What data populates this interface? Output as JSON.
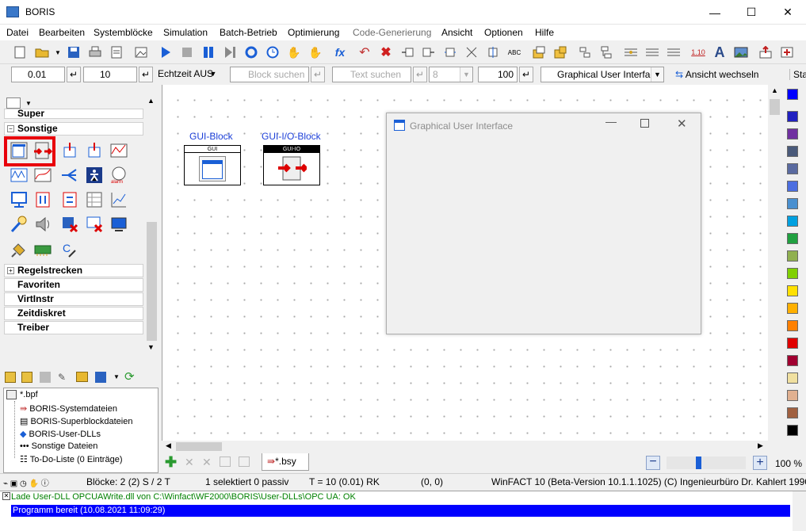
{
  "window": {
    "title": "BORIS",
    "minimize": "—",
    "maximize": "☐",
    "close": "✕"
  },
  "menu": [
    "Datei",
    "Bearbeiten",
    "Systemblöcke",
    "Simulation",
    "Batch-Betrieb",
    "Optimierung",
    "Code-Generierung",
    "Ansicht",
    "Optionen",
    "Hilfe"
  ],
  "menu_disabled": "Code-Generierung",
  "toolbar2": {
    "step_value": "0.01",
    "end_value": "10",
    "realtime": "Echtzeit AUS",
    "block_search_placeholder": "Block suchen",
    "text_search_placeholder": "Text suchen",
    "text_search_count": "8",
    "width_value": "100",
    "view_select": "Graphical User Interface",
    "switch_view": "Ansicht wechseln",
    "overflow": "Sta"
  },
  "palette": {
    "headers_top": [
      {
        "label": "Super",
        "state": "+"
      },
      {
        "label": "Sonstige",
        "state": "−"
      }
    ],
    "headers_bottom": [
      {
        "label": "Regelstrecken",
        "state": "+"
      },
      {
        "label": "Favoriten",
        "state": ""
      },
      {
        "label": "VirtInstr",
        "state": ""
      },
      {
        "label": "Zeitdiskret",
        "state": ""
      },
      {
        "label": "Treiber",
        "state": ""
      }
    ]
  },
  "tree": {
    "root": "*.bpf",
    "items": [
      "BORIS-Systemdateien",
      "BORIS-Superblockdateien",
      "BORIS-User-DLLs",
      "Sonstige Dateien",
      "To-Do-Liste (0 Einträge)"
    ]
  },
  "canvas": {
    "blocks": [
      {
        "title": "GUI-Block",
        "label": "GUI"
      },
      {
        "title": "GUI-I/O-Block",
        "label": "GUI-IO"
      }
    ]
  },
  "gui_window": {
    "title": "Graphical User Interface"
  },
  "tab": {
    "label": "*.bsy"
  },
  "zoom": {
    "value": "100 %",
    "level": 0.4
  },
  "status": {
    "blocks": "Blöcke: 2 (2) S / 2 T",
    "selection": "1 selektiert  0 passiv",
    "time": "T = 10  (0.01)  RK",
    "coords": "(0, 0)",
    "version": "WinFACT 10 (Beta-Version 10.1.1.1025)  (C) Ingenieurbüro Dr. Kahlert 1990, 2"
  },
  "messages": [
    "Lade User-DLL OPCUAWrite.dll von C:\\Winfact\\WF2000\\BORIS\\User-DLLs\\OPC UA: OK",
    "Programm bereit   (10.08.2021 11:09:29)"
  ],
  "colors": {
    "accent": "#0000ff",
    "block_title": "#1c3fd8",
    "highlight": "#e8000b",
    "message_ok": "#008000",
    "swatches": [
      "#0000ff",
      "#2020c0",
      "#7030a0",
      "#4a5a7a",
      "#5a6aa0",
      "#4c6ee0",
      "#4a90d0",
      "#00a0e0",
      "#20a040",
      "#90b050",
      "#80d000",
      "#ffe000",
      "#ffb000",
      "#ff8000",
      "#e00000",
      "#a00030",
      "#f0e0a0",
      "#e0b090",
      "#a06040",
      "#000000"
    ]
  }
}
